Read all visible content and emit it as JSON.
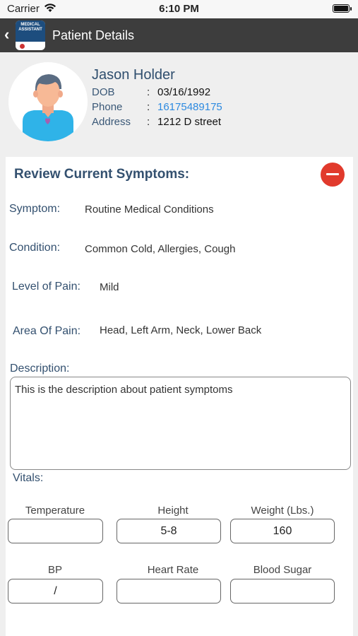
{
  "status_bar": {
    "carrier": "Carrier",
    "time": "6:10 PM"
  },
  "nav": {
    "back_glyph": "‹",
    "logo_text": "MEDICAL ASSISTANT",
    "title": "Patient Details"
  },
  "patient": {
    "name": "Jason Holder",
    "dob_label": "DOB",
    "dob": "03/16/1992",
    "phone_label": "Phone",
    "phone": "16175489175",
    "address_label": "Address",
    "address": "1212 D street",
    "colon": ":"
  },
  "symptoms": {
    "title": "Review Current Symptoms:",
    "symptom_label": "Symptom:",
    "symptom_value": "Routine Medical Conditions",
    "condition_label": "Condition:",
    "condition_value": "Common Cold, Allergies, Cough",
    "pain_level_label": "Level of Pain:",
    "pain_level_value": "Mild",
    "pain_area_label": "Area Of Pain:",
    "pain_area_value": "Head, Left Arm, Neck, Lower Back",
    "description_label": "Description:",
    "description_value": "This is the description about patient symptoms"
  },
  "vitals": {
    "label": "Vitals:",
    "temperature_label": "Temperature",
    "temperature_value": "",
    "height_label": "Height",
    "height_value": "5-8",
    "weight_label": "Weight (Lbs.)",
    "weight_value": "160",
    "bp_label": "BP",
    "bp_value": "/",
    "heart_rate_label": "Heart Rate",
    "heart_rate_value": "",
    "blood_sugar_label": "Blood Sugar",
    "blood_sugar_value": ""
  },
  "colors": {
    "nav_bg": "#3d3d3d",
    "accent_blue": "#33506f",
    "link_blue": "#2d8ae0",
    "remove_red": "#e13a2c"
  },
  "icons": {
    "wifi": "wifi-icon",
    "battery": "battery-icon",
    "back": "chevron-left-icon",
    "remove": "minus-circle-icon",
    "avatar": "user-avatar-icon"
  }
}
